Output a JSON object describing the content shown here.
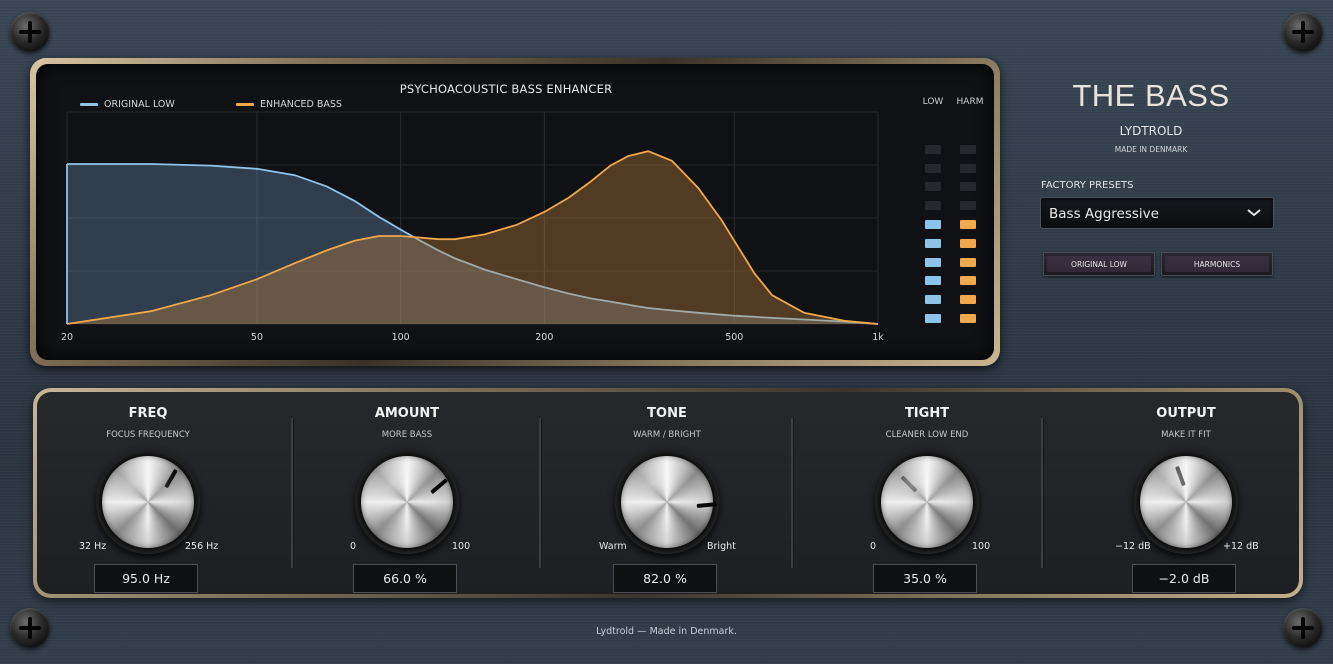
{
  "app": {
    "brand_title": "THE BASS",
    "brand_company": "LYDTROLD",
    "brand_tagline": "MADE IN DENMARK",
    "footer": "Lydtrold — Made in Denmark."
  },
  "presets": {
    "label": "FACTORY PRESETS",
    "selected": "Bass Aggressive"
  },
  "toggles": [
    {
      "label": "ORIGINAL LOW"
    },
    {
      "label": "HARMONICS"
    }
  ],
  "chart_data": {
    "type": "area",
    "title": "PSYCHOACOUSTIC BASS ENHANCER",
    "x_scale": "log",
    "xlim": [
      20,
      1000
    ],
    "tick_labels": [
      "20",
      "50",
      "100",
      "200",
      "500",
      "1k"
    ],
    "tick_values": [
      20,
      50,
      100,
      200,
      500,
      1000
    ],
    "ylim": [
      0,
      1
    ],
    "grid": true,
    "legend": "top-left",
    "x": [
      20,
      30,
      40,
      50,
      60,
      70,
      80,
      90,
      100,
      110,
      120,
      130,
      150,
      175,
      200,
      225,
      250,
      275,
      300,
      330,
      370,
      420,
      470,
      500,
      550,
      600,
      700,
      850,
      1000
    ],
    "series": [
      {
        "name": "ORIGINAL LOW",
        "color": "#8ec3ea",
        "values": [
          1.0,
          1.0,
          0.99,
          0.97,
          0.93,
          0.86,
          0.77,
          0.67,
          0.59,
          0.52,
          0.46,
          0.41,
          0.34,
          0.28,
          0.23,
          0.19,
          0.16,
          0.14,
          0.12,
          0.1,
          0.085,
          0.07,
          0.058,
          0.052,
          0.045,
          0.038,
          0.028,
          0.015,
          0.0
        ]
      },
      {
        "name": "ENHANCED BASS",
        "color": "#f0a84a",
        "values": [
          0.0,
          0.08,
          0.18,
          0.28,
          0.38,
          0.46,
          0.52,
          0.55,
          0.55,
          0.54,
          0.53,
          0.53,
          0.56,
          0.62,
          0.7,
          0.79,
          0.89,
          0.99,
          1.05,
          1.08,
          1.02,
          0.85,
          0.65,
          0.52,
          0.32,
          0.18,
          0.07,
          0.02,
          0.0
        ]
      }
    ]
  },
  "meters": {
    "low_label": "LOW",
    "harm_label": "HARM",
    "low_level": 6,
    "harm_level": 6,
    "segments": 10
  },
  "knobs": [
    {
      "title": "FREQ",
      "subtitle": "FOCUS FREQUENCY",
      "min_label": "32 Hz",
      "max_label": "256 Hz",
      "value": "95.0 Hz",
      "rotation_deg": 30
    },
    {
      "title": "AMOUNT",
      "subtitle": "MORE BASS",
      "min_label": "0",
      "max_label": "100",
      "value": "66.0 %",
      "rotation_deg": 50
    },
    {
      "title": "TONE",
      "subtitle": "WARM  /  BRIGHT",
      "min_label": "Warm",
      "max_label": "Bright",
      "value": "82.0 %",
      "rotation_deg": 85
    },
    {
      "title": "TIGHT",
      "subtitle": "CLEANER LOW END",
      "min_label": "0",
      "max_label": "100",
      "value": "35.0 %",
      "rotation_deg": -45
    },
    {
      "title": "OUTPUT",
      "subtitle": "MAKE IT FIT",
      "min_label": "−12 dB",
      "max_label": "+12 dB",
      "value": "−2.0 dB",
      "rotation_deg": -20
    }
  ]
}
